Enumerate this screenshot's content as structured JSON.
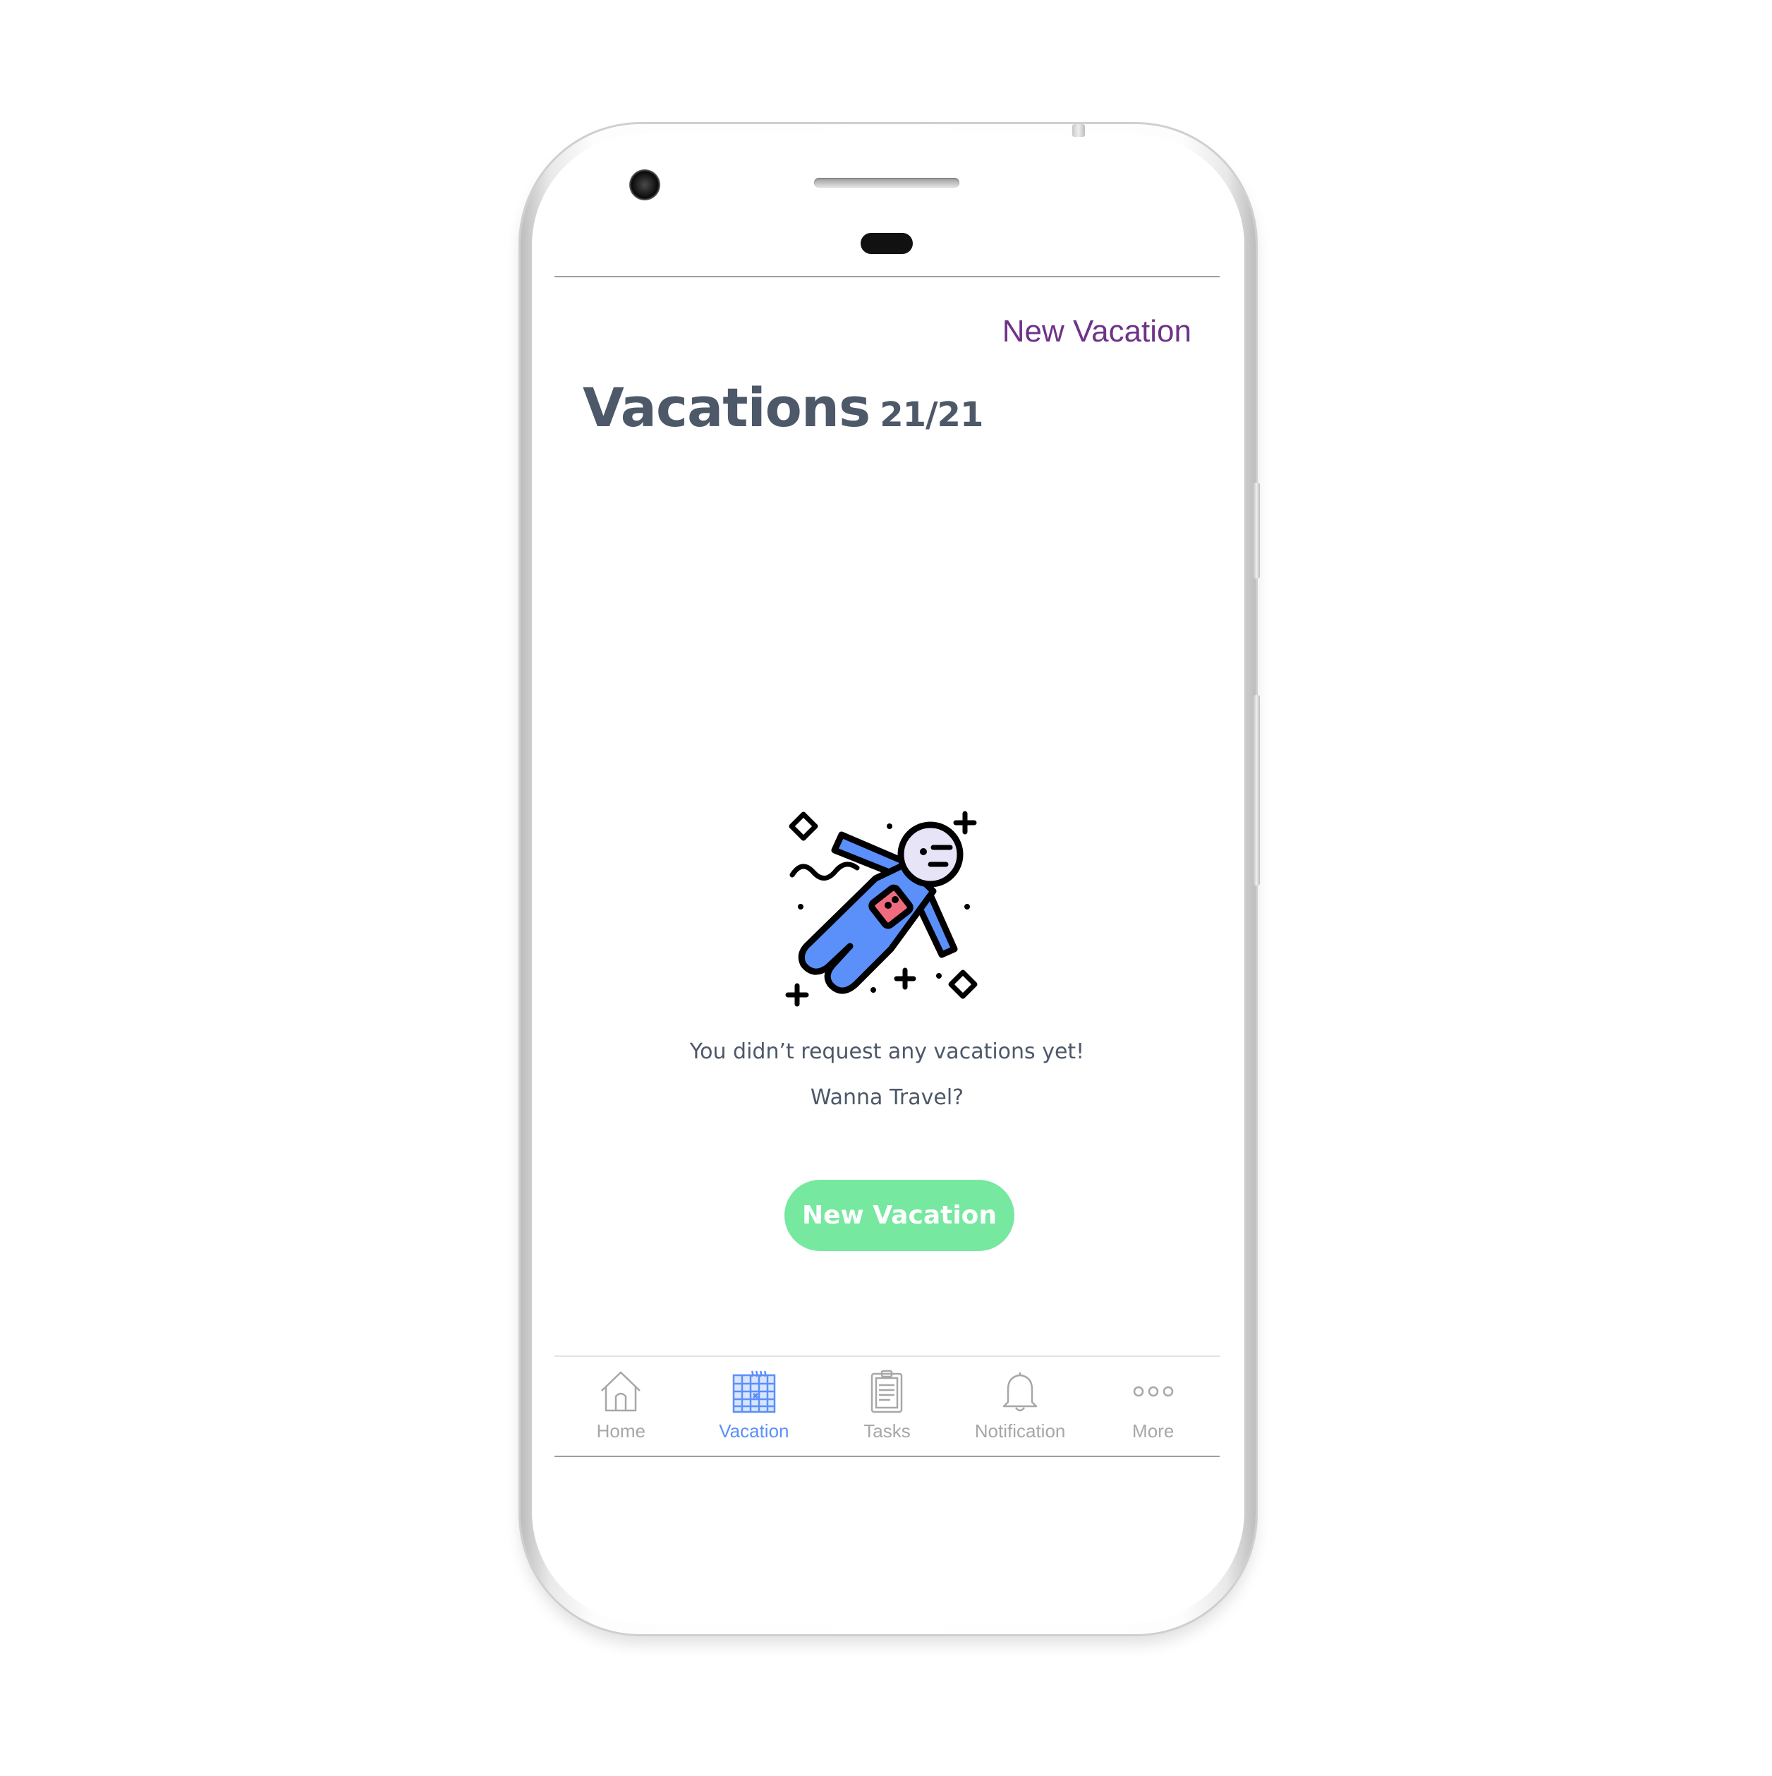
{
  "header": {
    "action_label": "New Vacation"
  },
  "page": {
    "title": "Vacations",
    "count": "21/21"
  },
  "empty_state": {
    "illustration_icon": "astronaut-floating-icon",
    "message": "You didn’t request any vacations yet!",
    "prompt": "Wanna Travel?",
    "cta_label": "New Vacation"
  },
  "tabbar": {
    "active_tab": "vacation",
    "tabs": [
      {
        "id": "home",
        "label": "Home",
        "icon": "home-icon"
      },
      {
        "id": "vacation",
        "label": "Vacation",
        "icon": "calendar-icon"
      },
      {
        "id": "tasks",
        "label": "Tasks",
        "icon": "clipboard-icon"
      },
      {
        "id": "notification",
        "label": "Notification",
        "icon": "bell-icon"
      },
      {
        "id": "more",
        "label": "More",
        "icon": "more-dots-icon"
      }
    ]
  },
  "colors": {
    "accent_purple": "#6e3387",
    "title_text": "#4d5868",
    "cta_green": "#76e8a0",
    "tab_active": "#5b8ff9",
    "tab_inactive": "#a7a7a7"
  }
}
